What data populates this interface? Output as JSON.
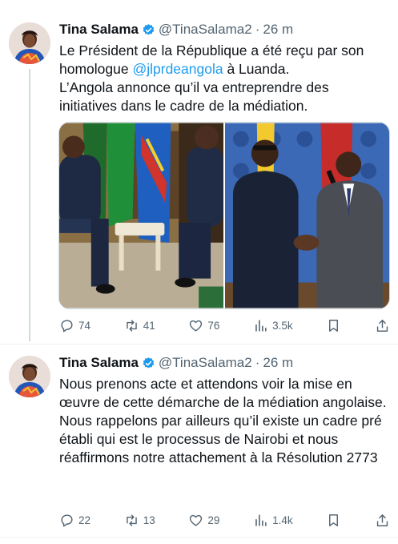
{
  "tweets": [
    {
      "name": "Tina Salama",
      "handle": "@TinaSalama2",
      "separator": "·",
      "time": "26 m",
      "text_line1_pre": "Le Président de la République a été reçu par son homologue ",
      "mention": "@jlprdeangola",
      "text_line1_post": " à Luanda.",
      "text_line2": "L’Angola annonce qu’il va entreprendre des initiatives dans le cadre de la médiation.",
      "replies": "74",
      "reposts": "41",
      "likes": "76",
      "views": "3.5k"
    },
    {
      "name": "Tina Salama",
      "handle": "@TinaSalama2",
      "separator": "·",
      "time": "26 m",
      "text_line1": "Nous prenons acte et  attendons voir la mise en œuvre de cette démarche de la médiation angolaise.",
      "text_line2": "Nous rappelons par ailleurs qu’il existe un cadre pré établi qui est le processus de Nairobi et nous réaffirmons notre attachement à la Résolution 2773",
      "replies": "22",
      "reposts": "13",
      "likes": "29",
      "views": "1.4k"
    }
  ],
  "colors": {
    "text": "#0f1419",
    "secondary": "#536471",
    "link": "#1d9bf0",
    "verified": "#1d9bf0",
    "divider": "#eff3f4"
  },
  "icons": [
    "verified-badge-icon",
    "reply-icon",
    "repost-icon",
    "like-icon",
    "views-icon",
    "bookmark-icon",
    "share-icon"
  ]
}
